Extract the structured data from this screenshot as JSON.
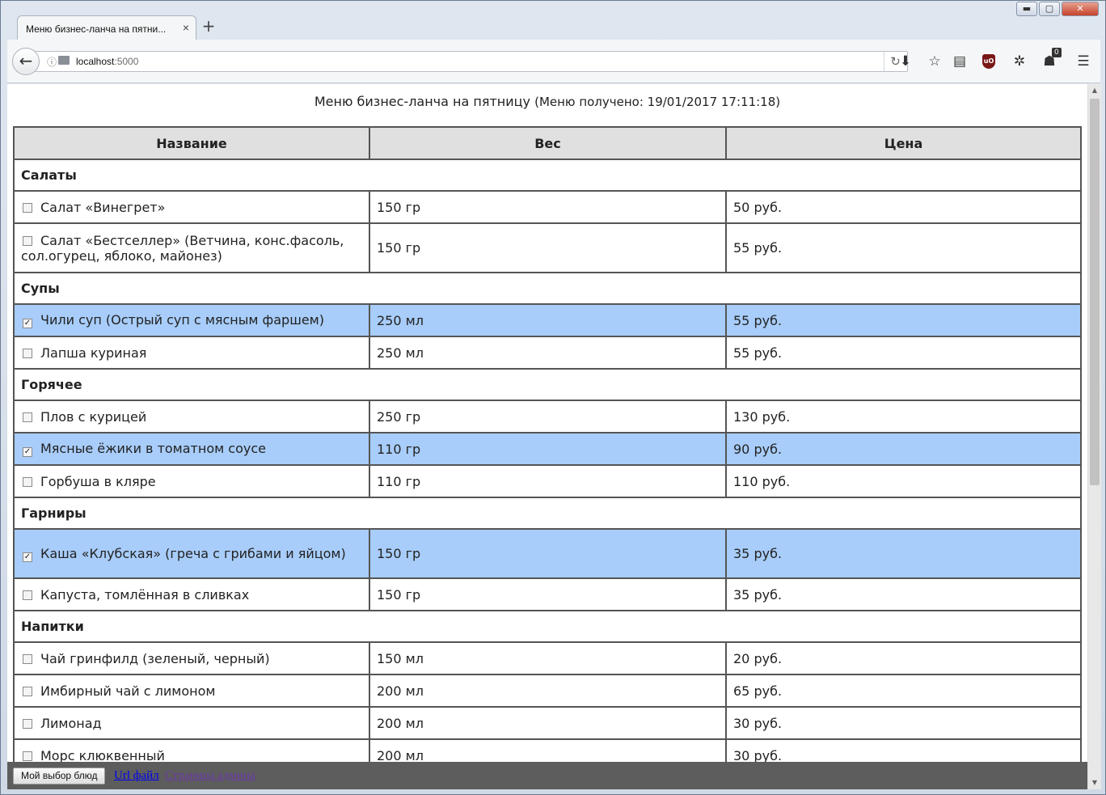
{
  "browser": {
    "tab_title": "Меню бизнес-ланча на пятни...",
    "tab_close": "×",
    "new_tab": "+",
    "url_host": "localhost",
    "url_port": ":5000",
    "ublock_label": "uO",
    "badge_count": "0"
  },
  "window_controls": {
    "minimize": "▬",
    "maximize": "▢",
    "close": "✕"
  },
  "page": {
    "heading": "Меню бизнес-ланча на пятницу",
    "received": "(Меню получено: 19/01/2017 17:11:18)",
    "columns": {
      "name": "Название",
      "weight": "Вес",
      "price": "Цена"
    },
    "categories": {
      "salads": "Салаты",
      "soups": "Супы",
      "hot": "Горячее",
      "sides": "Гарниры",
      "drinks": "Напитки"
    },
    "items": [
      {
        "name": "Салат «Винегрет»",
        "weight": "150 гр",
        "price": "50 руб.",
        "checked": false
      },
      {
        "name": "Салат «Бестселлер» (Ветчина, конс.фасоль, сол.огурец, яблоко, майонез)",
        "weight": "150 гр",
        "price": "55 руб.",
        "checked": false
      },
      {
        "name": "Чили суп (Острый суп с мясным фаршем)",
        "weight": "250 мл",
        "price": "55 руб.",
        "checked": true
      },
      {
        "name": "Лапша куриная",
        "weight": "250 мл",
        "price": "55 руб.",
        "checked": false
      },
      {
        "name": "Плов с курицей",
        "weight": "250 гр",
        "price": "130 руб.",
        "checked": false
      },
      {
        "name": "Мясные ёжики в томатном соусе",
        "weight": "110 гр",
        "price": "90 руб.",
        "checked": true
      },
      {
        "name": "Горбуша в кляре",
        "weight": "110 гр",
        "price": "110 руб.",
        "checked": false
      },
      {
        "name": "Каша «Клубская» (греча с грибами и яйцом)",
        "weight": "150 гр",
        "price": "35 руб.",
        "checked": true
      },
      {
        "name": "Капуста, томлённая в сливках",
        "weight": "150 гр",
        "price": "35 руб.",
        "checked": false
      },
      {
        "name": "Чай гринфилд (зеленый, черный)",
        "weight": "150 мл",
        "price": "20 руб.",
        "checked": false
      },
      {
        "name": "Имбирный чай с лимоном",
        "weight": "200 мл",
        "price": "65 руб.",
        "checked": false
      },
      {
        "name": "Лимонад",
        "weight": "200 мл",
        "price": "30 руб.",
        "checked": false
      },
      {
        "name": "Морс клюквенный",
        "weight": "200 мл",
        "price": "30 руб.",
        "checked": false
      }
    ]
  },
  "bottom_bar": {
    "my_choice_button": "Мой выбор блюд",
    "url_file_link": "Url файл",
    "admin_link": "Страница админа"
  },
  "colors": {
    "selected_row": "#a8cdfa",
    "header_bg": "#e0e0e0",
    "bottom_bar": "#5d5d5d"
  }
}
